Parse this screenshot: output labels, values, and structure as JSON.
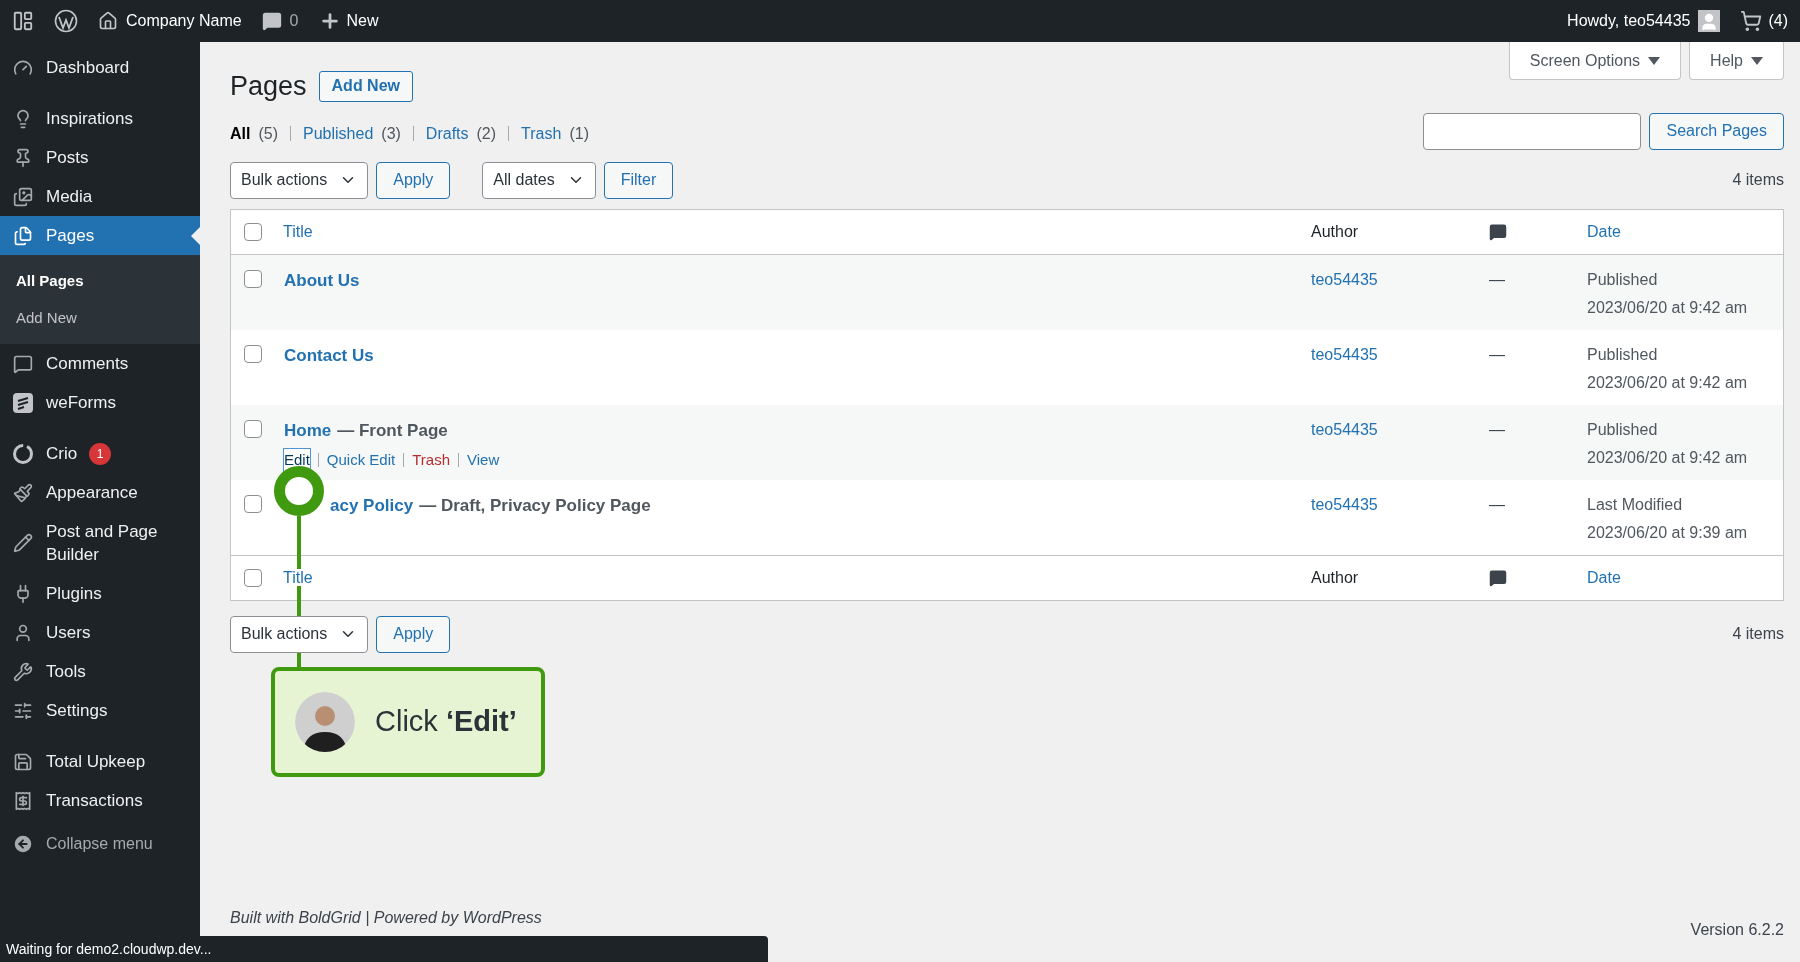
{
  "top_bar": {
    "site_name": "Company Name",
    "comments_count": "0",
    "new_label": "New",
    "greeting": "Howdy, teo54435",
    "cart_count": "(4)"
  },
  "sidebar": {
    "sections": [
      {
        "items": [
          {
            "label": "Dashboard",
            "selected": false
          }
        ]
      },
      {
        "items": [
          {
            "label": "Inspirations",
            "selected": false
          },
          {
            "label": "Posts",
            "selected": false
          },
          {
            "label": "Media",
            "selected": false
          },
          {
            "label": "Pages",
            "selected": true,
            "children": [
              {
                "label": "All Pages",
                "selected": true
              },
              {
                "label": "Add New",
                "selected": false
              }
            ]
          },
          {
            "label": "Comments",
            "selected": false
          },
          {
            "label": "weForms",
            "selected": false
          }
        ]
      },
      {
        "items": [
          {
            "label": "Crio",
            "selected": false,
            "badge": "1"
          },
          {
            "label": "Appearance",
            "selected": false
          },
          {
            "label": "Post and Page Builder",
            "selected": false
          },
          {
            "label": "Plugins",
            "selected": false
          },
          {
            "label": "Users",
            "selected": false
          },
          {
            "label": "Tools",
            "selected": false
          },
          {
            "label": "Settings",
            "selected": false
          }
        ]
      },
      {
        "items": [
          {
            "label": "Total Upkeep",
            "selected": false
          },
          {
            "label": "Transactions",
            "selected": false
          }
        ]
      }
    ],
    "collapse_label": "Collapse menu"
  },
  "header": {
    "title": "Pages",
    "add_new": "Add New",
    "screen_options": "Screen Options",
    "help": "Help"
  },
  "filters": [
    {
      "label": "All",
      "count": "(5)",
      "selected": true
    },
    {
      "label": "Published",
      "count": "(3)",
      "selected": false
    },
    {
      "label": "Drafts",
      "count": "(2)",
      "selected": false
    },
    {
      "label": "Trash",
      "count": "(1)",
      "selected": false
    }
  ],
  "search_button": "Search Pages",
  "top_actions": {
    "bulk": "Bulk actions",
    "apply": "Apply",
    "dates": "All dates",
    "filter": "Filter",
    "count": "4 items"
  },
  "table": {
    "header": {
      "columns": [
        "Title",
        "Author",
        "Date"
      ],
      "checked": false
    },
    "footer": {
      "columns": [
        "Title",
        "Author",
        "Date"
      ],
      "checked": false
    },
    "rows": [
      {
        "title": "About Us",
        "suffix": "",
        "author": "teo54435",
        "comments": "—",
        "status": "Published",
        "date": "2023/06/20 at 9:42 am",
        "checked": false
      },
      {
        "title": "Contact Us",
        "suffix": "",
        "author": "teo54435",
        "comments": "—",
        "status": "Published",
        "date": "2023/06/20 at 9:42 am",
        "checked": false
      },
      {
        "title": "Home",
        "suffix": "— Front Page",
        "author": "teo54435",
        "comments": "—",
        "status": "Published",
        "date": "2023/06/20 at 9:42 am",
        "checked": false,
        "actions": [
          {
            "label": "Edit",
            "kind": "link",
            "focused": true
          },
          {
            "label": "Quick Edit",
            "kind": "link",
            "focused": false
          },
          {
            "label": "Trash",
            "kind": "danger",
            "focused": false
          },
          {
            "label": "View",
            "kind": "link",
            "focused": false
          }
        ]
      },
      {
        "title": "acy Policy",
        "suffix": "— Draft, Privacy Policy Page",
        "author": "teo54435",
        "comments": "—",
        "status": "Last Modified",
        "date": "2023/06/20 at 9:39 am",
        "checked": false
      }
    ]
  },
  "bottom_actions": {
    "bulk": "Bulk actions",
    "apply": "Apply",
    "count": "4 items"
  },
  "footer": {
    "credit": "Built with BoldGrid | Powered by WordPress",
    "version": "Version 6.2.2"
  },
  "callout": {
    "text": "Click **‘Edit’**"
  },
  "status_bar": "Waiting for demo2.cloudwp.dev..."
}
